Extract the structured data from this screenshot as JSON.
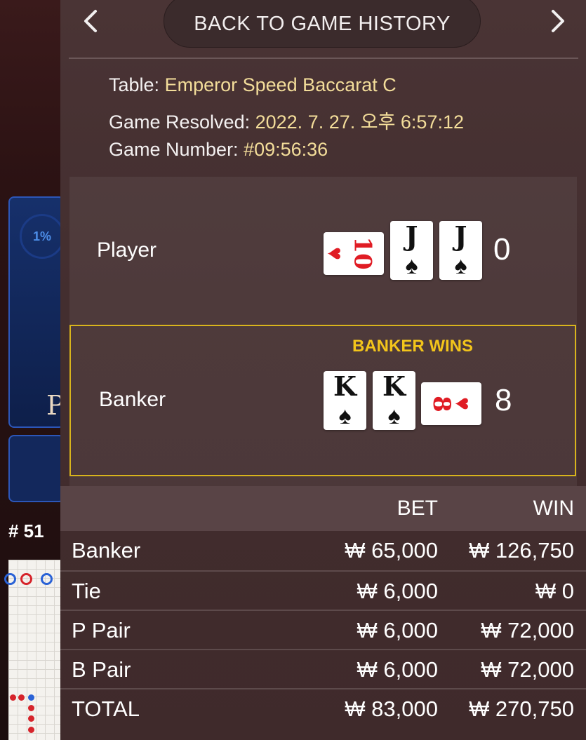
{
  "background": {
    "timer_percent": "1%",
    "table_letter": "P",
    "round_label": "# 51"
  },
  "header": {
    "back_label": "BACK TO GAME HISTORY",
    "prev_icon": "chevron-left-icon",
    "next_icon": "chevron-right-icon"
  },
  "info": {
    "table_label": "Table:",
    "table_value": "Emperor Speed Baccarat C",
    "resolved_label": "Game Resolved:",
    "resolved_value": "2022. 7. 27. 오후 6:57:12",
    "number_label": "Game Number:",
    "number_value": "#09:56:36"
  },
  "player": {
    "label": "Player",
    "score": "0",
    "cards": [
      {
        "rank": "10",
        "suit": "♥",
        "color": "red",
        "orientation": "sideways"
      },
      {
        "rank": "J",
        "suit": "♠",
        "color": "black",
        "orientation": "upright"
      },
      {
        "rank": "J",
        "suit": "♠",
        "color": "black",
        "orientation": "upright"
      }
    ]
  },
  "banker": {
    "label": "Banker",
    "score": "8",
    "winner_text": "BANKER WINS",
    "cards": [
      {
        "rank": "K",
        "suit": "♠",
        "color": "black",
        "orientation": "upright"
      },
      {
        "rank": "K",
        "suit": "♠",
        "color": "black",
        "orientation": "upright"
      },
      {
        "rank": "8",
        "suit": "♥",
        "color": "red",
        "orientation": "sideways"
      }
    ]
  },
  "bets": {
    "columns": [
      "BET",
      "WIN"
    ],
    "rows": [
      {
        "name": "Banker",
        "bet": "₩ 65,000",
        "win": "₩ 126,750"
      },
      {
        "name": "Tie",
        "bet": "₩ 6,000",
        "win": "₩ 0"
      },
      {
        "name": "P Pair",
        "bet": "₩ 6,000",
        "win": "₩ 72,000"
      },
      {
        "name": "B Pair",
        "bet": "₩ 6,000",
        "win": "₩ 72,000"
      },
      {
        "name": "TOTAL",
        "bet": "₩ 83,000",
        "win": "₩ 270,750"
      }
    ]
  },
  "colors": {
    "accent_gold": "#f3c51b",
    "info_value": "#f3dd9a",
    "red_suit": "#e01c24"
  }
}
